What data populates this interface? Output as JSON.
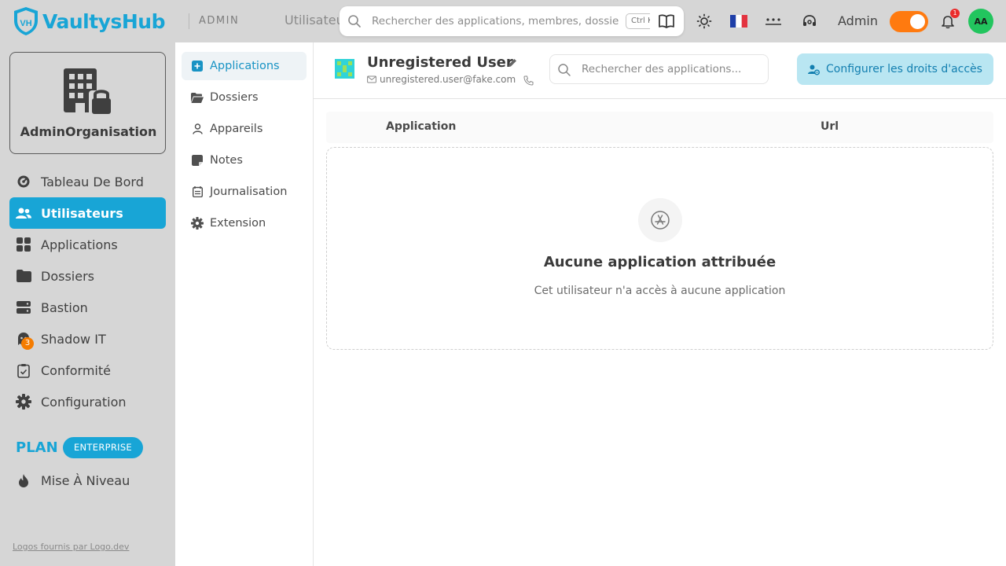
{
  "brand": {
    "name": "VaultysHub",
    "logo_letters": "VH",
    "color": "#18a5d6"
  },
  "topbar": {
    "mode_label": "ADMIN",
    "breadcrumb": "Utilisateurs",
    "search": {
      "placeholder": "Rechercher des applications, membres, dossiers...",
      "shortcut": "Ctrl K"
    },
    "icons": [
      "book-icon",
      "sun-icon",
      "france-flag-icon",
      "password-icon",
      "support-icon",
      "bell-icon"
    ],
    "user_name": "Admin",
    "toggle_on": true,
    "toggle_color": "#ff7a0f",
    "notification_count": "1",
    "avatar_initials": "AA"
  },
  "sidebar": {
    "organization": "AdminOrganisation",
    "items": [
      {
        "label": "Tableau De Bord",
        "icon": "dashboard-icon",
        "active": false
      },
      {
        "label": "Utilisateurs",
        "icon": "users-icon",
        "active": true
      },
      {
        "label": "Applications",
        "icon": "grid-icon",
        "active": false
      },
      {
        "label": "Dossiers",
        "icon": "folder-icon",
        "active": false
      },
      {
        "label": "Bastion",
        "icon": "server-icon",
        "active": false
      },
      {
        "label": "Shadow IT",
        "icon": "ghost-icon",
        "active": false,
        "badge": "3"
      },
      {
        "label": "Conformité",
        "icon": "clipboard-check-icon",
        "active": false
      },
      {
        "label": "Configuration",
        "icon": "gear-icon",
        "active": false
      }
    ],
    "plan_label": "PLAN",
    "plan_badge": "ENTERPRISE",
    "upgrade": {
      "label": "Mise À Niveau",
      "icon": "flame-icon"
    },
    "footer_link": "Logos fournis par Logo.dev"
  },
  "subnav": {
    "items": [
      {
        "label": "Applications",
        "icon": "app-square-icon",
        "active": true
      },
      {
        "label": "Dossiers",
        "icon": "folder-open-icon",
        "active": false
      },
      {
        "label": "Appareils",
        "icon": "person-icon",
        "active": false
      },
      {
        "label": "Notes",
        "icon": "note-icon",
        "active": false
      },
      {
        "label": "Journalisation",
        "icon": "log-icon",
        "active": false
      },
      {
        "label": "Extension",
        "icon": "gear-icon",
        "active": false
      }
    ]
  },
  "user": {
    "name": "Unregistered User",
    "email": "unregistered.user@fake.com"
  },
  "main": {
    "search_placeholder": "Rechercher des applications...",
    "configure_button": "Configurer les droits d'accès",
    "columns": [
      "Application",
      "Url"
    ],
    "empty": {
      "title": "Aucune application attribuée",
      "subtitle": "Cet utilisateur n'a accès à aucune application"
    }
  }
}
